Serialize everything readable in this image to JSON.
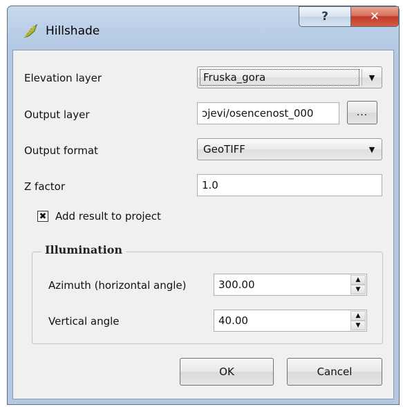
{
  "window": {
    "title": "Hillshade",
    "help_label": "?",
    "close_label": "✕"
  },
  "form": {
    "elevation_label": "Elevation layer",
    "elevation_value": "Fruska_gora",
    "output_label": "Output layer",
    "output_value": "ɔjevi/osencenost_000",
    "browse_label": "...",
    "format_label": "Output format",
    "format_value": "GeoTIFF",
    "zfactor_label": "Z factor",
    "zfactor_value": "1.0",
    "add_result_label": "Add result to project",
    "add_result_checked": true
  },
  "illumination": {
    "title": "Illumination",
    "azimuth_label": "Azimuth (horizontal angle)",
    "azimuth_value": "300.00",
    "vertical_label": "Vertical angle",
    "vertical_value": "40.00"
  },
  "buttons": {
    "ok": "OK",
    "cancel": "Cancel"
  },
  "icons": {
    "app": "qgis-leaf-icon",
    "dropdown": "chevron-down-icon",
    "spin": "spin-arrows-icon"
  }
}
